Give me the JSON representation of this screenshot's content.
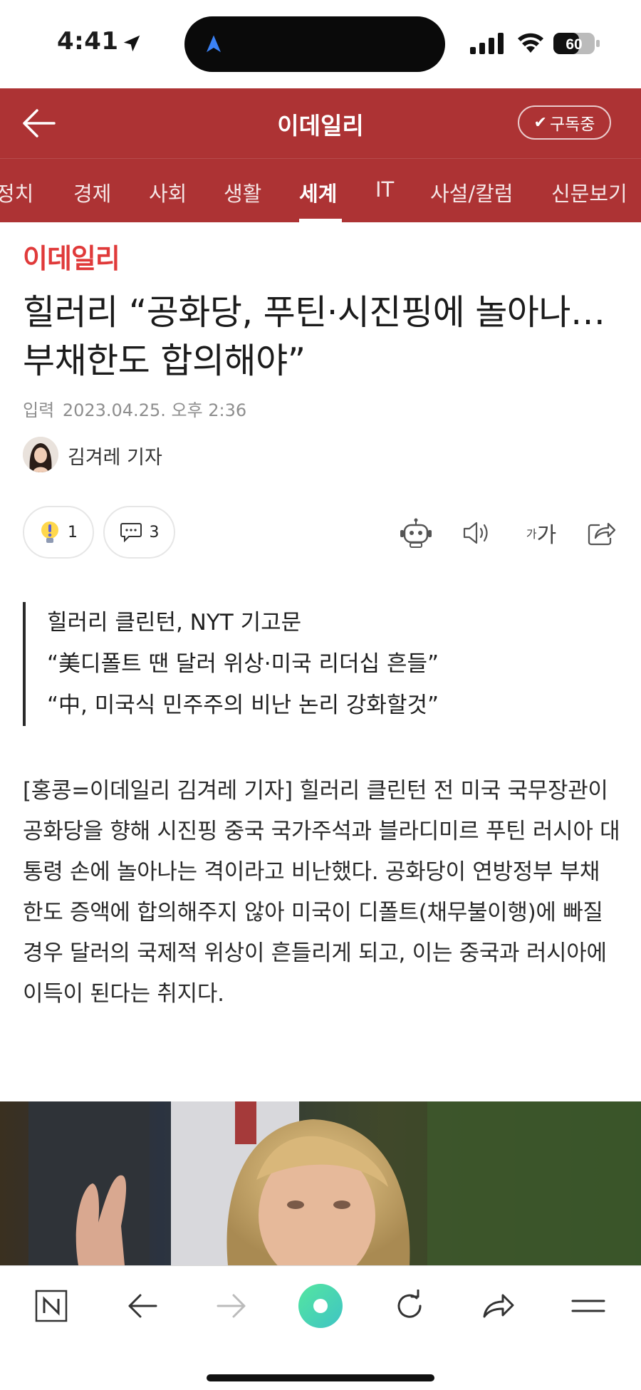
{
  "status": {
    "time": "4:41",
    "battery": "60"
  },
  "header": {
    "title": "이데일리",
    "subscribe_label": "구독중"
  },
  "nav": {
    "categories": [
      "정치",
      "경제",
      "사회",
      "생활",
      "세계",
      "IT",
      "사설/칼럼",
      "신문보기"
    ],
    "active": "세계"
  },
  "article": {
    "logo": "이데일리",
    "headline": "힐러리 “공화당, 푸틴·시진핑에 놀아나…부채한도 합의해야”",
    "date_label": "입력",
    "date": "2023.04.25. 오후 2:36",
    "reporter": "김겨레 기자",
    "likes": "1",
    "comments": "3",
    "font_label_small": "가",
    "font_label_large": "가",
    "summary": [
      "힐러리 클린턴, NYT 기고문",
      "“美디폴트 땐 달러 위상·미국 리더십 흔들”",
      "“中, 미국식 민주주의 비난 논리 강화할것”"
    ],
    "body": "[홍콩=이데일리 김겨레 기자] 힐러리 클린턴 전 미국 국무장관이 공화당을 향해 시진핑 중국 국가주석과 블라디미르 푸틴 러시아 대통령 손에 놀아나는 격이라고 비난했다. 공화당이 연방정부 부채 한도 증액에 합의해주지 않아 미국이 디폴트(채무불이행)에 빠질 경우 달러의 국제적 위상이 흔들리게 되고, 이는 중국과 러시아에 이득이 된다는 취지다."
  },
  "colors": {
    "brand_red": "#ad3334",
    "logo_red": "#e03a3a",
    "accent_green": "#4fd8a3"
  },
  "icons": {
    "back": "back-arrow-icon",
    "like": "lightbulb-icon",
    "comment": "speech-bubble-icon",
    "robot": "robot-icon",
    "speaker": "speaker-icon",
    "share": "share-icon",
    "naver": "naver-n-icon",
    "menu": "menu-icon"
  }
}
